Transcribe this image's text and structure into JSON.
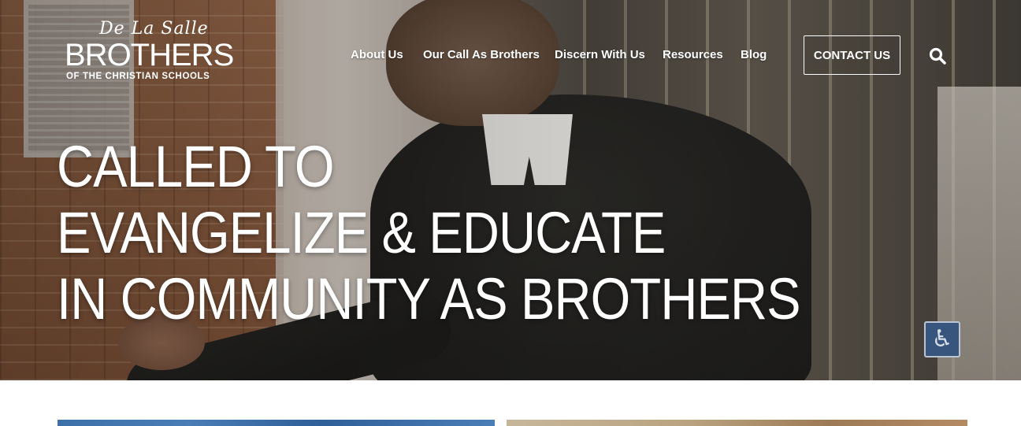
{
  "logo": {
    "script_text": "De La Salle",
    "main_text": "BROTHERS",
    "sub_text": "OF THE CHRISTIAN SCHOOLS"
  },
  "nav": {
    "items": [
      {
        "label": "About Us"
      },
      {
        "label": "Our Call As Brothers"
      },
      {
        "label": "Discern With Us"
      },
      {
        "label": "Resources"
      },
      {
        "label": "Blog"
      }
    ],
    "contact_label": "CONTACT US",
    "search_icon": "search-icon"
  },
  "hero": {
    "headline_lines": [
      "CALLED TO",
      "EVANGELIZE & EDUCATE",
      "IN COMMUNITY AS BROTHERS"
    ],
    "accessibility_sign": "♿"
  },
  "colors": {
    "text_on_hero": "#ffffff",
    "card_left": "#3d6fa8",
    "card_right": "#b9a27f"
  }
}
